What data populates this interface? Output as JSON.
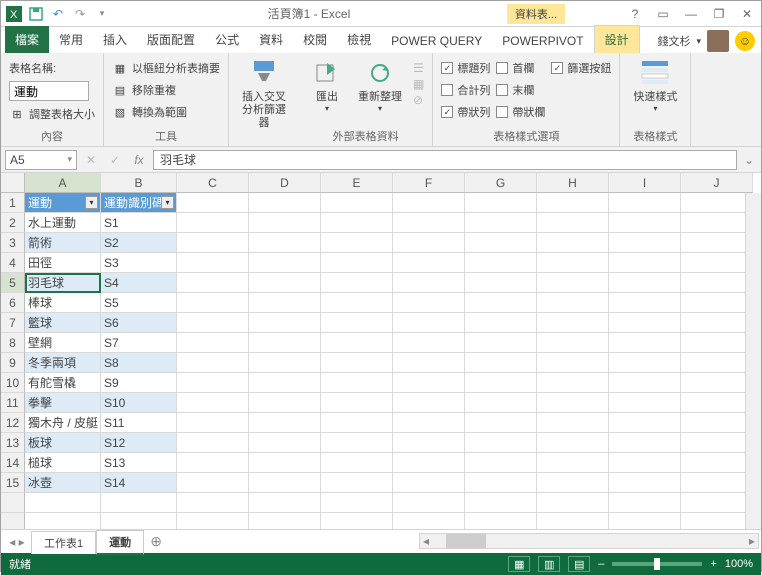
{
  "title": "活頁簿1 - Excel",
  "tool_context": "資料表...",
  "user_name": "錢文杉",
  "tabs": {
    "file": "檔案",
    "home": "常用",
    "insert": "插入",
    "layout": "版面配置",
    "formula": "公式",
    "data": "資料",
    "review": "校閱",
    "view": "檢視",
    "pq": "POWER QUERY",
    "pp": "POWERPIVOT",
    "design": "設計"
  },
  "ribbon": {
    "g1": {
      "name_lbl": "表格名稱:",
      "name_val": "運動",
      "resize": "調整表格大小",
      "title": "內容"
    },
    "g2": {
      "pivot": "以樞紐分析表摘要",
      "dup": "移除重複",
      "range": "轉換為範圍",
      "title": "工具"
    },
    "g3": {
      "slicer": "插入交叉\n分析篩選器"
    },
    "g4": {
      "export": "匯出",
      "refresh": "重新整理",
      "title": "外部表格資料"
    },
    "g5": {
      "header": "標題列",
      "total": "合計列",
      "band": "帶狀列",
      "first": "首欄",
      "last": "末欄",
      "bandc": "帶狀欄",
      "filter": "篩選按鈕",
      "title": "表格樣式選項"
    },
    "g6": {
      "quick": "快速樣式",
      "title": "表格樣式"
    }
  },
  "namebox": "A5",
  "formula": "羽毛球",
  "cols": [
    "A",
    "B",
    "C",
    "D",
    "E",
    "F",
    "G",
    "H",
    "I",
    "J"
  ],
  "headers": {
    "a": "運動",
    "b": "運動識別碼"
  },
  "rows": [
    {
      "n": 1,
      "a": "",
      "b": ""
    },
    {
      "n": 2,
      "a": "水上運動",
      "b": "S1"
    },
    {
      "n": 3,
      "a": "箭術",
      "b": "S2"
    },
    {
      "n": 4,
      "a": "田徑",
      "b": "S3"
    },
    {
      "n": 5,
      "a": "羽毛球",
      "b": "S4"
    },
    {
      "n": 6,
      "a": "棒球",
      "b": "S5"
    },
    {
      "n": 7,
      "a": "籃球",
      "b": "S6"
    },
    {
      "n": 8,
      "a": "壁網",
      "b": "S7"
    },
    {
      "n": 9,
      "a": "冬季兩項",
      "b": "S8"
    },
    {
      "n": 10,
      "a": "有舵雪橇",
      "b": "S9"
    },
    {
      "n": 11,
      "a": "拳擊",
      "b": "S10"
    },
    {
      "n": 12,
      "a": "獨木舟 / 皮艇",
      "b": "S11"
    },
    {
      "n": 13,
      "a": "板球",
      "b": "S12"
    },
    {
      "n": 14,
      "a": "槌球",
      "b": "S13"
    },
    {
      "n": 15,
      "a": "冰壺",
      "b": "S14"
    }
  ],
  "sheets": {
    "s1": "工作表1",
    "s2": "運動"
  },
  "status": {
    "ready": "就緒",
    "zoom": "100%"
  }
}
